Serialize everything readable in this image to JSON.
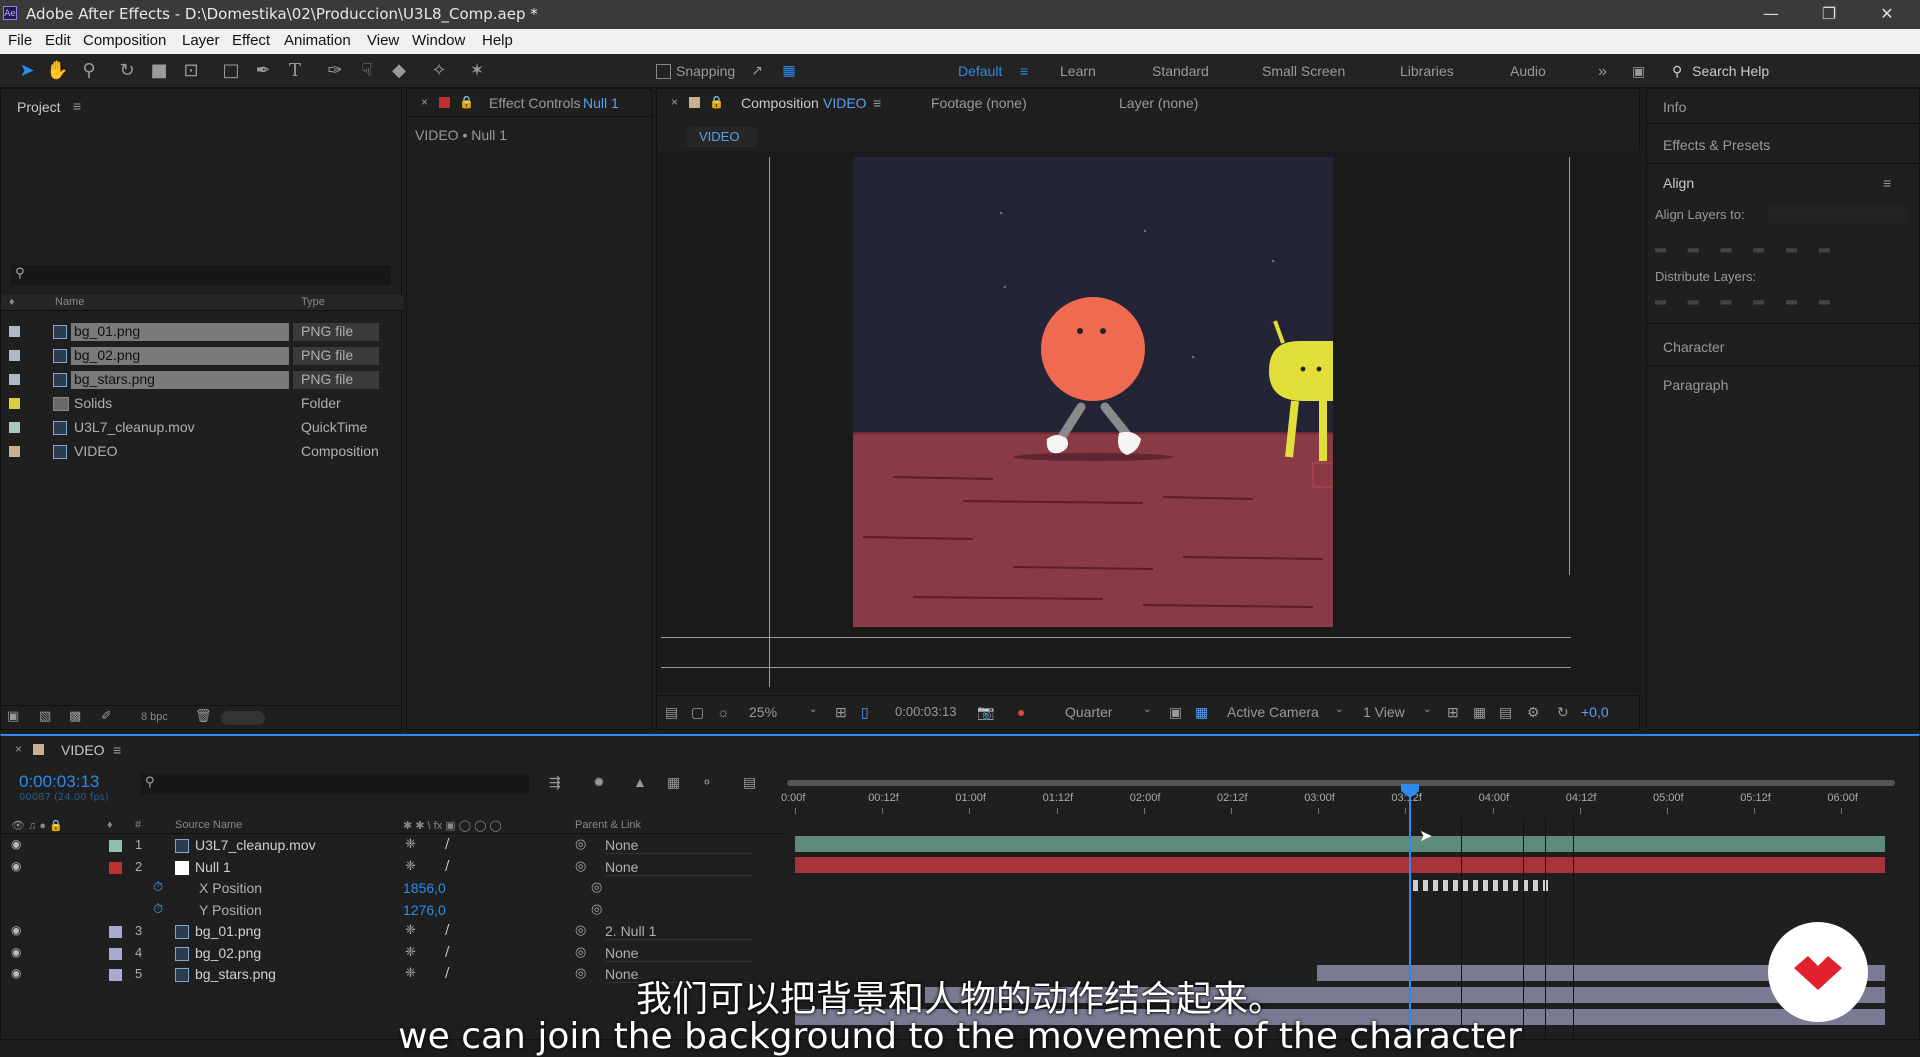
{
  "window": {
    "title": "Adobe After Effects - D:\\Domestika\\02\\Produccion\\U3L8_Comp.aep *",
    "logo": "Ae"
  },
  "menu": [
    "File",
    "Edit",
    "Composition",
    "Layer",
    "Effect",
    "Animation",
    "View",
    "Window",
    "Help"
  ],
  "toolbar": {
    "snapping": "Snapping",
    "workspaces": [
      "Default",
      "Learn",
      "Standard",
      "Small Screen",
      "Libraries",
      "Audio"
    ],
    "active_workspace": "Default",
    "search_placeholder": "Search Help"
  },
  "project": {
    "title": "Project",
    "columns": {
      "name": "Name",
      "type": "Type"
    },
    "items": [
      {
        "name": "bg_01.png",
        "type": "PNG file",
        "label_color": "#b0b8c8",
        "selected": true
      },
      {
        "name": "bg_02.png",
        "type": "PNG file",
        "label_color": "#b0b8c8",
        "selected": true
      },
      {
        "name": "bg_stars.png",
        "type": "PNG file",
        "label_color": "#b0b8c8",
        "selected": true
      },
      {
        "name": "Solids",
        "type": "Folder",
        "label_color": "#d8d040",
        "selected": false
      },
      {
        "name": "U3L7_cleanup.mov",
        "type": "QuickTime",
        "label_color": "#a8c8c0",
        "selected": false
      },
      {
        "name": "VIDEO",
        "type": "Composition",
        "label_color": "#c8b090",
        "selected": false
      }
    ],
    "bpc": "8 bpc"
  },
  "effect_controls": {
    "tab": "Effect Controls",
    "layer": "Null 1",
    "breadcrumb": "VIDEO • Null 1"
  },
  "composition": {
    "tab": "Composition",
    "comp_name": "VIDEO",
    "footage": "Footage (none)",
    "layer": "Layer (none)",
    "flowchart_tab": "VIDEO",
    "zoom": "25%",
    "timecode": "0:00:03:13",
    "resolution": "Quarter",
    "camera": "Active Camera",
    "views": "1 View",
    "exposure": "+0,0"
  },
  "right_panels": {
    "info": "Info",
    "effects_presets": "Effects & Presets",
    "align": "Align",
    "align_layers_to": "Align Layers to:",
    "distribute_layers": "Distribute Layers:",
    "character": "Character",
    "paragraph": "Paragraph"
  },
  "timeline": {
    "comp": "VIDEO",
    "timecode": "0:00:03:13",
    "frame_info": "00087 (24.00 fps)",
    "columns": {
      "num": "#",
      "source": "Source Name",
      "parent": "Parent & Link"
    },
    "ruler": [
      "0:00f",
      "00:12f",
      "01:00f",
      "01:12f",
      "02:00f",
      "02:12f",
      "03:00f",
      "03:12f",
      "04:00f",
      "04:12f",
      "05:00f",
      "05:12f",
      "06:00f"
    ],
    "layers": [
      {
        "num": "1",
        "name": "U3L7_cleanup.mov",
        "parent": "None",
        "label_color": "#8fc0b0"
      },
      {
        "num": "2",
        "name": "Null 1",
        "parent": "None",
        "label_color": "#c03030"
      },
      {
        "num": "3",
        "name": "bg_01.png",
        "parent": "2. Null 1",
        "label_color": "#a8a8d0"
      },
      {
        "num": "4",
        "name": "bg_02.png",
        "parent": "None",
        "label_color": "#a8a8d0"
      },
      {
        "num": "5",
        "name": "bg_stars.png",
        "parent": "None",
        "label_color": "#a8a8d0"
      }
    ],
    "properties": [
      {
        "name": "X Position",
        "value": "1856,0"
      },
      {
        "name": "Y Position",
        "value": "1276,0"
      }
    ]
  },
  "subtitles": {
    "zh": "我们可以把背景和人物的动作结合起来。",
    "en": "we can join the background to the movement of the character"
  },
  "colors": {
    "accent": "#2d8ceb",
    "bg_sky": "#232536",
    "ground": "#8a3a44",
    "ball": "#ef6a50",
    "yellow_char": "#e3df3a"
  }
}
